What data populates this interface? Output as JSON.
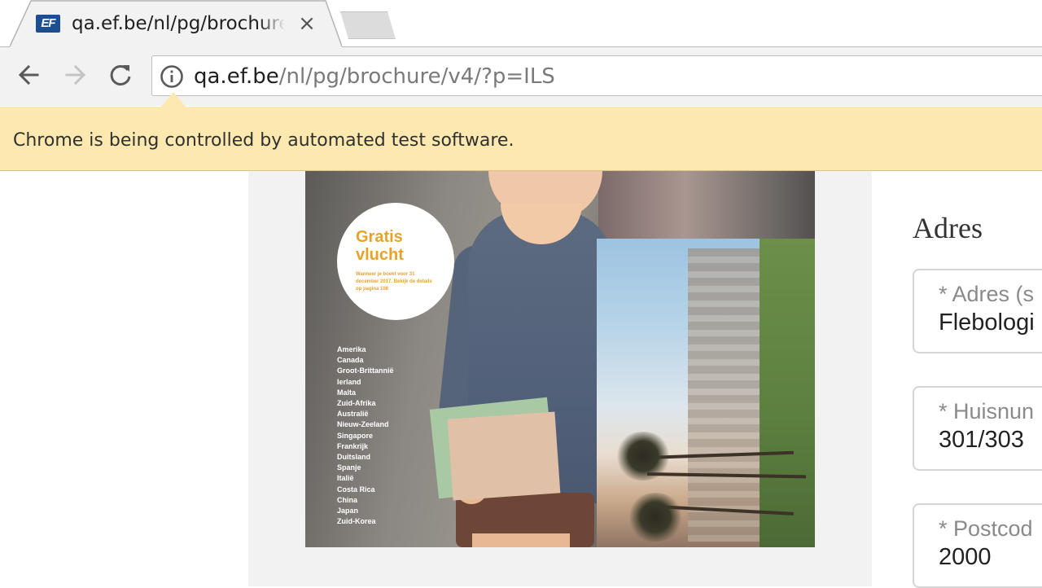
{
  "browser": {
    "tab": {
      "title": "qa.ef.be/nl/pg/brochure/",
      "favicon_text": "EF",
      "close_glyph": "×"
    },
    "url": {
      "host": "qa.ef.be",
      "path": "/nl/pg/brochure/v4/?p=ILS"
    },
    "infobar_message": "Chrome is being controlled by automated test software."
  },
  "brochure": {
    "badge_title": "Gratis vlucht",
    "badge_text": "Wanneer je boekt voor 31 december 2017. Bekijk de details op pagina 108",
    "countries": [
      "Amerika",
      "Canada",
      "Groot-Brittannië",
      "Ierland",
      "Malta",
      "Zuid-Afrika",
      "Australië",
      "Nieuw-Zeeland",
      "Singapore",
      "Frankrijk",
      "Duitsland",
      "Spanje",
      "Italië",
      "Costa Rica",
      "China",
      "Japan",
      "Zuid-Korea"
    ]
  },
  "form": {
    "heading": "Adres",
    "fields": [
      {
        "label": "* Adres (s",
        "value": "Flebologi"
      },
      {
        "label": "* Huisnun",
        "value": "301/303"
      },
      {
        "label": "* Postcod",
        "value": "2000"
      }
    ]
  },
  "colors": {
    "infobar": "#fde8b0",
    "badge_text": "#e8a22a",
    "favicon_bg": "#1b4f8f"
  }
}
